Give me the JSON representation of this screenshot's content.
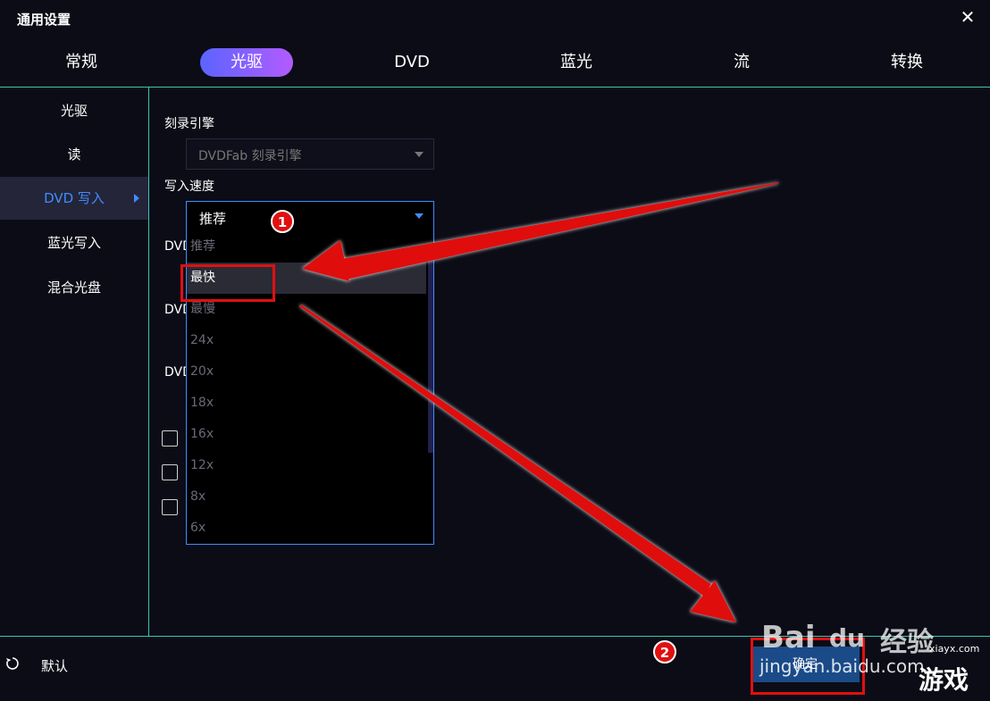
{
  "window": {
    "title": "通用设置",
    "close_glyph": "✕"
  },
  "tabs": [
    {
      "label": "常规"
    },
    {
      "label": "光驱"
    },
    {
      "label": "DVD"
    },
    {
      "label": "蓝光"
    },
    {
      "label": "流"
    },
    {
      "label": "转换"
    }
  ],
  "sidebar": {
    "items": [
      {
        "label": "光驱"
      },
      {
        "label": "读"
      },
      {
        "label": "DVD 写入"
      },
      {
        "label": "蓝光写入"
      },
      {
        "label": "混合光盘"
      }
    ]
  },
  "main": {
    "burn_engine_label": "刻录引擎",
    "burn_engine_value": "DVDFab 刻录引擎",
    "write_speed_label": "写入速度",
    "write_speed_value": "推荐",
    "speed_options": [
      "推荐",
      "最快",
      "最慢",
      "24x",
      "20x",
      "18x",
      "16x",
      "12x",
      "8x",
      "6x"
    ],
    "partial_labels": [
      "DVD",
      "DVD",
      "DVD"
    ]
  },
  "footer": {
    "reset_label": "默认",
    "ok_label": "确定"
  },
  "annotations": {
    "badge_1": "1",
    "badge_2": "2"
  },
  "watermark": {
    "brand": "Bai",
    "brand2": "du",
    "brand3": "经验",
    "url": "jingyan.baidu.com",
    "site": "xiayx.com",
    "game": "游戏"
  },
  "colors": {
    "accent": "#3f8cff",
    "divider": "#3ec6b8",
    "annotation_red": "#e01010"
  }
}
